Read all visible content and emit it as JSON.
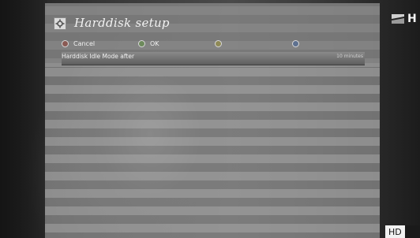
{
  "osd": {
    "title": "Harddisk setup",
    "title_icon": "settings-icon",
    "buttons": [
      {
        "label": "Cancel",
        "color": "red"
      },
      {
        "label": "OK",
        "color": "green"
      },
      {
        "label": "",
        "color": "yellow"
      },
      {
        "label": "",
        "color": "blue"
      }
    ],
    "setting": {
      "label": "Harddisk Idle Mode after",
      "value": "10 minutes"
    }
  },
  "overlay": {
    "channel_logo_text": "H",
    "hd_badge": "HD"
  }
}
